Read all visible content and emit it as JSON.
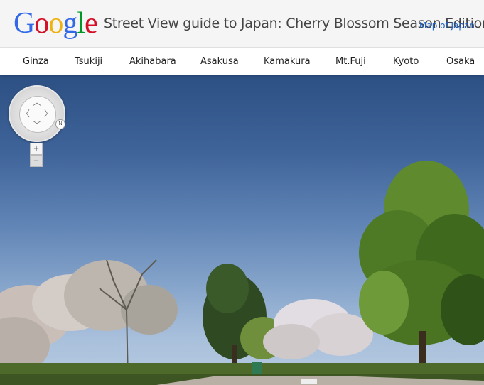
{
  "header": {
    "logo_letters": [
      {
        "ch": "G",
        "color": "#3369e8"
      },
      {
        "ch": "o",
        "color": "#d50f25"
      },
      {
        "ch": "o",
        "color": "#eeb211"
      },
      {
        "ch": "g",
        "color": "#3369e8"
      },
      {
        "ch": "l",
        "color": "#009925"
      },
      {
        "ch": "e",
        "color": "#d50f25"
      }
    ],
    "title": "Street View guide to Japan: Cherry Blossom Season Edition",
    "map_link": "Map of Japan"
  },
  "nav": {
    "items": [
      "Ginza",
      "Tsukiji",
      "Akihabara",
      "Asakusa",
      "Kamakura",
      "Mt.Fuji",
      "Kyoto",
      "Osaka"
    ]
  },
  "controls": {
    "zoom_in": "+",
    "zoom_out": "−",
    "compass_label": "N"
  }
}
